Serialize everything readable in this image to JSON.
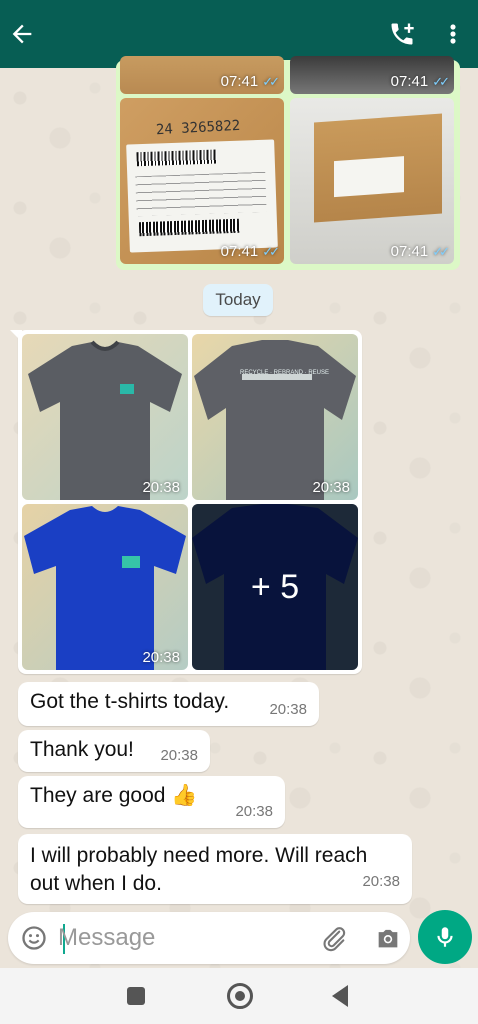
{
  "header": {
    "back_icon": "arrow-back-icon",
    "call_icon": "add-call-icon",
    "menu_icon": "more-vert-icon"
  },
  "sent_media": {
    "times": [
      "07:41",
      "07:41",
      "07:41",
      "07:41"
    ],
    "label_text_1": "24 3265822",
    "read_ticks": "✓✓"
  },
  "date_chip": "Today",
  "received_media": {
    "times": [
      "20:38",
      "20:38",
      "20:38"
    ],
    "more_count": "+ 5",
    "logo_text": "RECYCLE · REBRAND · REUSE"
  },
  "messages": [
    {
      "text": "Got the t-shirts today.",
      "time": "20:38"
    },
    {
      "text": "Thank you!",
      "time": "20:38"
    },
    {
      "text": "They are good 👍",
      "time": "20:38"
    },
    {
      "text": "I will probably need more. Will reach out when I do.",
      "time": "20:38"
    }
  ],
  "composer": {
    "placeholder": "Message",
    "emoji_icon": "emoji-icon",
    "attach_icon": "paperclip-icon",
    "camera_icon": "camera-icon",
    "mic_icon": "microphone-icon"
  },
  "colors": {
    "header": "#075e54",
    "sent_bubble": "#dcf8c6",
    "mic": "#00a884",
    "tick_read": "#53bdeb"
  }
}
